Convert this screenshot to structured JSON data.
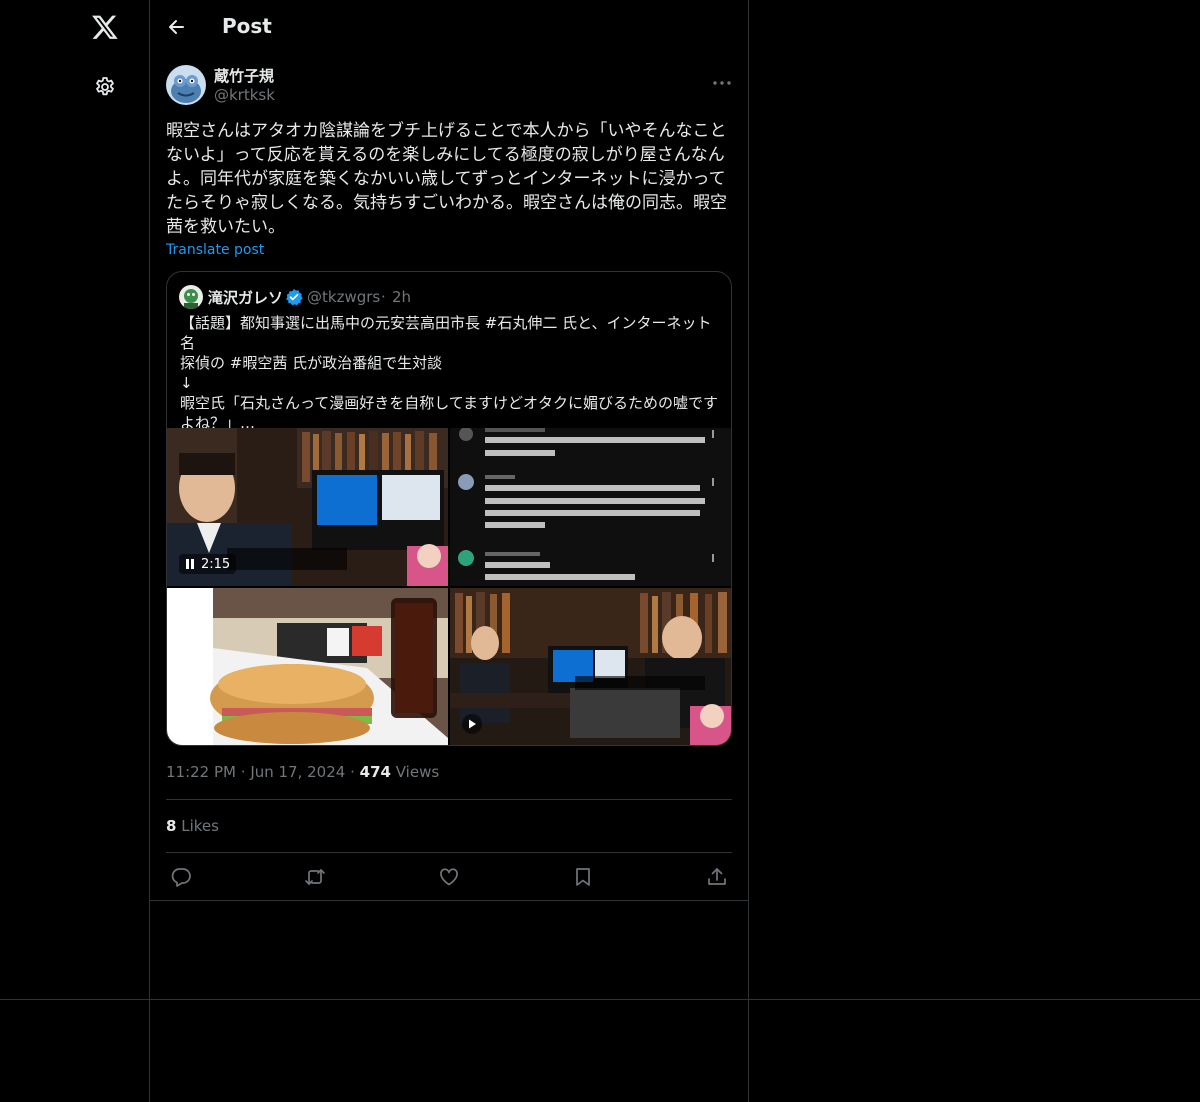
{
  "header": {
    "title": "Post"
  },
  "post": {
    "author_name": "蔵竹子規",
    "author_handle": "@krtksk",
    "text": "暇空さんはアタオカ陰謀論をブチ上げることで本人から「いやそんなこと\nないよ」って反応を貰えるのを楽しみにしてる極度の寂しがり屋さんなん\nよ。同年代が家庭を築くなかいい歳してずっとインターネットに浸かって\nたらそりゃ寂しくなる。気持ちすごいわかる。暇空さんは俺の同志。暇空\n茜を救いたい。",
    "translate_label": "Translate post",
    "time": "11:22 PM",
    "date": "Jun 17, 2024",
    "views_count": "474",
    "views_label": "Views",
    "likes_count": "8",
    "likes_label": "Likes"
  },
  "quote": {
    "name": "滝沢ガレソ",
    "handle": "@tkzwgrs",
    "dot": "·",
    "time": "2h",
    "text": "【話題】都知事選に出馬中の元安芸高田市長 #石丸伸二 氏と、インターネット名\n探偵の #暇空茜 氏が政治番組で生対談\n↓\n暇空氏「石丸さんって漫画好きを自称してますけどオタクに媚びるための嘘です\nよね？」…",
    "video_time": "2:15"
  },
  "colors": {
    "background": "#000000",
    "border": "#2f3336",
    "text_primary": "#e7e9ea",
    "text_secondary": "#71767b",
    "link": "#1d9bf0",
    "verified": "#1d9bf0"
  },
  "icons": {
    "logo": "x-logo-icon",
    "settings": "gear-icon",
    "back": "arrow-left-icon",
    "more": "more-horizontal-icon",
    "reply": "reply-icon",
    "repost": "repost-icon",
    "like": "heart-icon",
    "bookmark": "bookmark-icon",
    "share": "share-icon"
  }
}
